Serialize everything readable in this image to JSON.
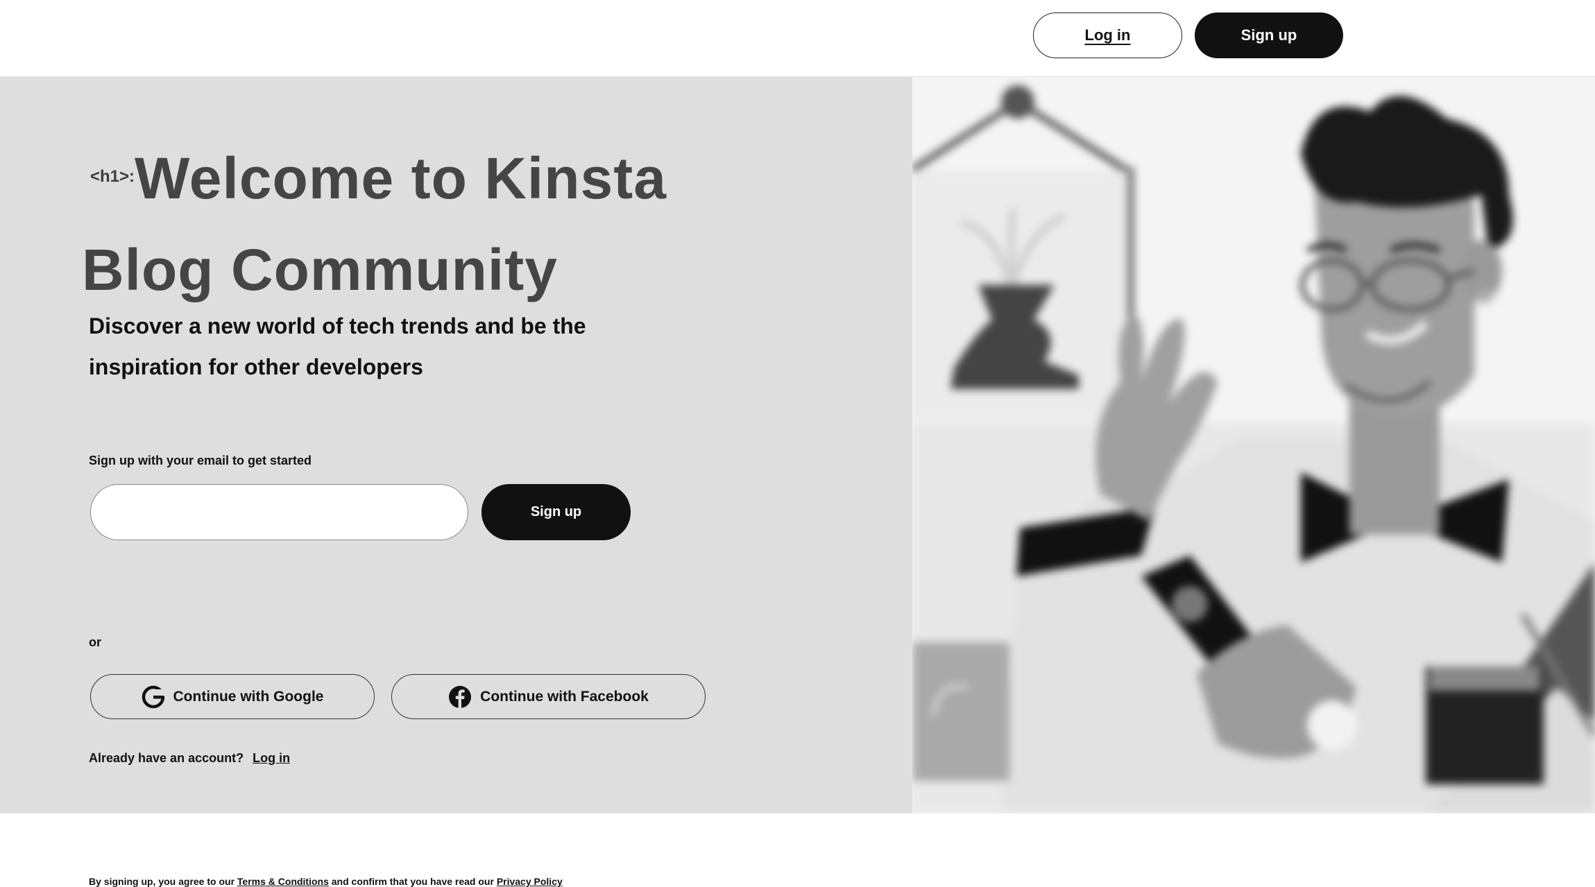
{
  "header": {
    "login_label": "Log in",
    "signup_label": "Sign up"
  },
  "hero": {
    "h1_tag": "<h1>:",
    "headline": "Welcome to Kinsta Blog Community",
    "subhead": "Discover a new world of tech trends and be the inspiration for other developers"
  },
  "form": {
    "email_label": "Sign up with your email to get started",
    "email_placeholder": "",
    "signup_label": "Sign up",
    "or_text": "or",
    "google_label": "Continue with Google",
    "facebook_label": "Continue with Facebook",
    "login_prompt": "Already have an account?",
    "login_link": "Log in"
  },
  "footer": {
    "terms_prefix": "By signing up, you agree to our",
    "terms_link": "Terms & Conditions",
    "terms_middle": "and confirm that you have read our",
    "privacy_link": "Privacy Policy"
  },
  "illustration": {
    "name": "man-waving-holding-phone-illustration"
  },
  "colors": {
    "left_bg": "#dedede",
    "button_dark": "#111111",
    "headline": "#454545"
  }
}
